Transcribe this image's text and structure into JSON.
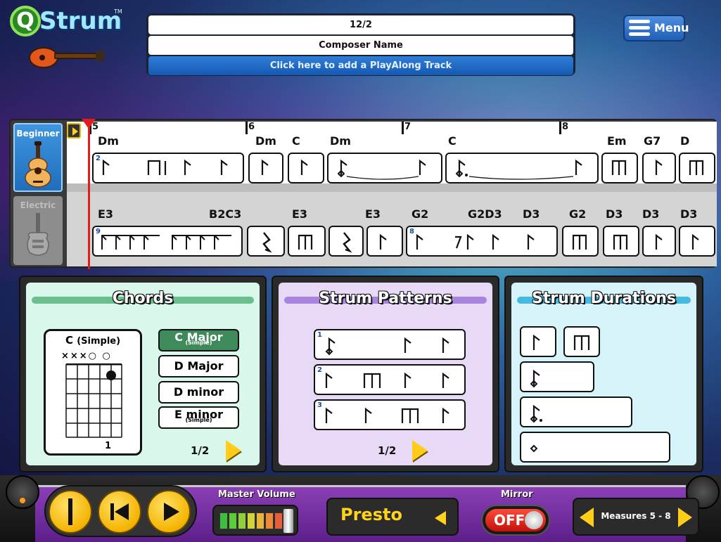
{
  "app": {
    "logo_text": "Strum",
    "logo_q": "Q",
    "logo_tm": "TM"
  },
  "header": {
    "time_signature": "12/2",
    "composer": "Composer Name",
    "playalong": "Click here to add a PlayAlong Track",
    "menu_label": "Menu"
  },
  "instruments": [
    {
      "label": "Beginner",
      "icon": "acoustic-guitar-icon",
      "selected": true
    },
    {
      "label": "Electric",
      "icon": "electric-guitar-icon",
      "selected": false
    }
  ],
  "score": {
    "measure_numbers": [
      "5",
      "6",
      "7",
      "8"
    ],
    "lane1_chords": [
      "Dm",
      "Dm",
      "C",
      "Dm",
      "C",
      "Em",
      "G7",
      "D"
    ],
    "lane2_chords": [
      "E3",
      "B2C3",
      "E3",
      "E3",
      "G2",
      "G2D3",
      "D3",
      "G2",
      "D3",
      "D3",
      "D3"
    ],
    "lane1_first_pattern": "2",
    "lane2_first_pattern": "9",
    "lane2_pattern_m7": "8"
  },
  "chords_panel": {
    "title": "Chords",
    "diagram_name": "C",
    "diagram_variant": "(Simple)",
    "diagram_marks": "×××○ ○",
    "diagram_fret": "1",
    "options": [
      {
        "label": "C Major",
        "sub": "(Simple)",
        "selected": true
      },
      {
        "label": "D Major",
        "sub": "",
        "selected": false
      },
      {
        "label": "D minor",
        "sub": "",
        "selected": false
      },
      {
        "label": "E minor",
        "sub": "(Simple)",
        "selected": false
      }
    ],
    "page": "1/2"
  },
  "patterns_panel": {
    "title": "Strum Patterns",
    "numbers": [
      "1",
      "2",
      "3"
    ],
    "page": "1/2"
  },
  "durations_panel": {
    "title": "Strum Durations"
  },
  "transport": {
    "master_volume_label": "Master Volume",
    "volume_level": 0.85,
    "tempo": "Presto",
    "mirror_label": "Mirror",
    "mirror_state": "OFF",
    "measures": "Measures 5 - 8"
  },
  "colors": {
    "chords_panel_bg": "#d9f7ea",
    "chords_bar": "#6bbf8e",
    "patterns_panel_bg": "#e8daf7",
    "patterns_bar": "#a984de",
    "durations_panel_bg": "#d7f3fa",
    "durations_bar": "#46b9e0",
    "accent_yellow": "#ffcc1a",
    "cursor_red": "#e21b1b"
  }
}
